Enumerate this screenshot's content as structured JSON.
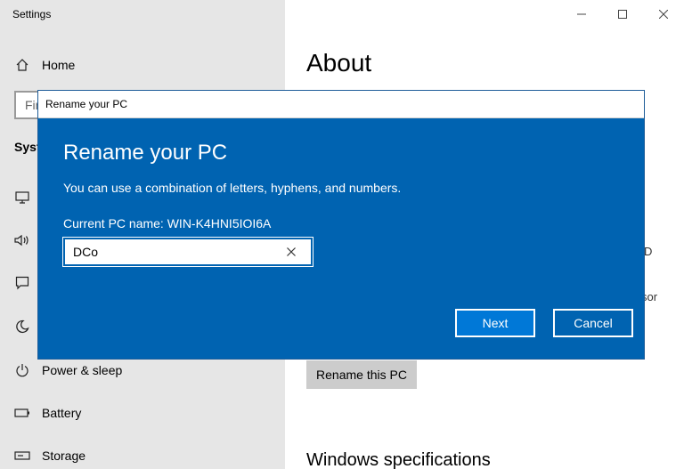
{
  "app": {
    "title": "Settings"
  },
  "sidebar": {
    "home_label": "Home",
    "find_placeholder": "Fin",
    "section_heading": "Syst",
    "items": [
      {
        "icon": "display-icon",
        "label": ""
      },
      {
        "icon": "sound-icon",
        "label": ""
      },
      {
        "icon": "notifications-icon",
        "label": ""
      },
      {
        "icon": "focus-assist-icon",
        "label": ""
      },
      {
        "icon": "power-icon",
        "label": "Power & sleep"
      },
      {
        "icon": "battery-icon",
        "label": "Battery"
      },
      {
        "icon": "storage-icon",
        "label": "Storage"
      }
    ]
  },
  "main": {
    "page_title": "About",
    "fragment_1": "D",
    "fragment_2": "sor",
    "rename_button": "Rename this PC",
    "section_title": "Windows specifications"
  },
  "dialog": {
    "window_title": "Rename your PC",
    "heading": "Rename your PC",
    "description": "You can use a combination of letters, hyphens, and numbers.",
    "current_name": "Current PC name: WIN-K4HNI5IOI6A",
    "input_value": "DCo",
    "next_label": "Next",
    "cancel_label": "Cancel"
  },
  "colors": {
    "dialog_bg": "#0063b1",
    "accent": "#0078d7",
    "sidebar_bg": "#e6e6e6"
  }
}
